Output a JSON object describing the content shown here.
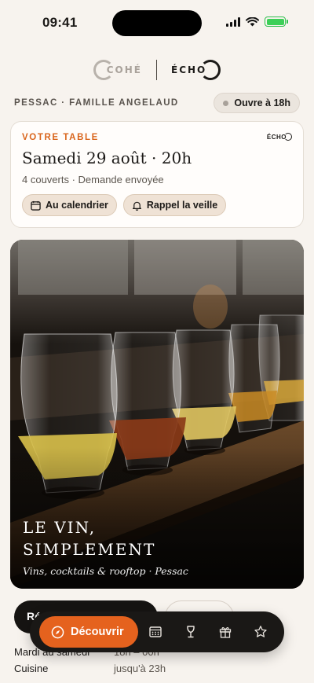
{
  "status": {
    "time": "09:41"
  },
  "brand": {
    "left_logo": "COHÉ",
    "right_logo": "ÉCHO"
  },
  "location": {
    "label": "PESSAC · FAMILLE ANGELAUD",
    "open_status": "Ouvre à 18h"
  },
  "reservation": {
    "kicker": "VOTRE TABLE",
    "card_logo": "ÉCHO",
    "title": "Samedi 29 août · 20h",
    "details": "4 couverts · Demande envoyée",
    "actions": {
      "calendar": "Au calendrier",
      "reminder": "Rappel la veille"
    }
  },
  "hero": {
    "title": "LE VIN, SIMPLEMENT",
    "subtitle": "Vins, cocktails & rooftop · Pessac"
  },
  "cta": {
    "primary_label": "Ré"
  },
  "hours": [
    {
      "day": "Mardi au samedi",
      "time": "18h – 00h"
    },
    {
      "day": "Cuisine",
      "time": "jusqu'à 23h"
    }
  ],
  "tabbar": {
    "primary_label": "Découvrir",
    "icons": [
      "menu-icon",
      "wine-glass-icon",
      "gift-icon",
      "star-icon"
    ]
  },
  "colors": {
    "accent": "#e5621e",
    "kicker": "#d9651c",
    "dark": "#1a1816",
    "background": "#f7f3ee"
  }
}
